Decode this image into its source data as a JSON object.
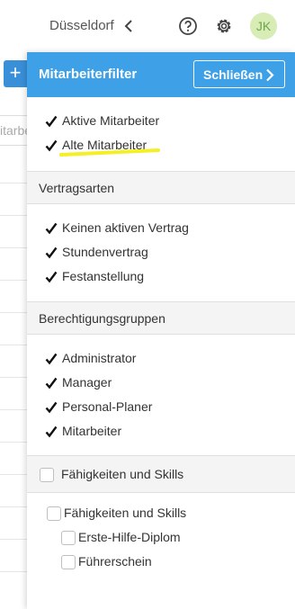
{
  "header": {
    "location": "Düsseldorf",
    "avatar_initials": "JK",
    "icons": [
      "chevron-left-icon",
      "help-icon",
      "gear-icon"
    ]
  },
  "background": {
    "search_placeholder_fragment": "itarbe",
    "add_label": "+"
  },
  "panel": {
    "title": "Mitarbeiterfilter",
    "close_label": "Schließen",
    "accent_color": "#3ea0e6",
    "status_items": [
      {
        "label": "Aktive Mitarbeiter",
        "checked": true
      },
      {
        "label": "Alte Mitarbeiter",
        "checked": true,
        "highlighted": true
      }
    ],
    "contract_section": {
      "heading": "Vertragsarten",
      "items": [
        {
          "label": "Keinen aktiven Vertrag",
          "checked": true
        },
        {
          "label": "Stundenvertrag",
          "checked": true
        },
        {
          "label": "Festanstellung",
          "checked": true
        }
      ]
    },
    "permission_section": {
      "heading": "Berechtigungsgruppen",
      "items": [
        {
          "label": "Administrator",
          "checked": true
        },
        {
          "label": "Manager",
          "checked": true
        },
        {
          "label": "Personal-Planer",
          "checked": true
        },
        {
          "label": "Mitarbeiter",
          "checked": true
        }
      ]
    },
    "skills_section": {
      "heading": "Fähigkeiten und Skills",
      "checked": false,
      "group": {
        "label": "Fähigkeiten und Skills",
        "checked": false
      },
      "items": [
        {
          "label": "Erste-Hilfe-Diplom",
          "checked": false
        },
        {
          "label": "Führerschein",
          "checked": false
        }
      ]
    }
  }
}
